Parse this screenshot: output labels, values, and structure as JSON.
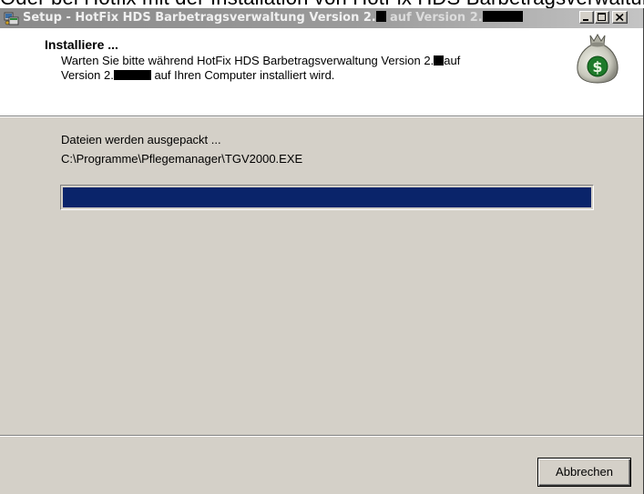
{
  "background_text": "Oder bei Hotfix mit der Installation von HotFix HDS Barbetragsverwaltung",
  "window": {
    "title_prefix": "Setup - HotFix HDS Barbetragsverwaltung Version 2.",
    "title_middle": "auf Version 2.",
    "titlebar_buttons": [
      "minimize-icon",
      "maximize-icon",
      "close-icon"
    ]
  },
  "header": {
    "title": "Installiere ...",
    "desc_part1": "Warten Sie bitte während HotFix HDS Barbetragsverwaltung Version 2.",
    "desc_part2": "auf",
    "desc_part3": "Version 2.",
    "desc_part4": "auf Ihren Computer installiert wird.",
    "icon": "money-bag-icon"
  },
  "status": {
    "line1": "Dateien werden ausgepackt ...",
    "line2": "C:\\Programme\\Pflegemanager\\TGV2000.EXE"
  },
  "progress": {
    "fraction": 1.0,
    "color": "#0a246a"
  },
  "buttons": {
    "cancel": "Abbrechen"
  }
}
